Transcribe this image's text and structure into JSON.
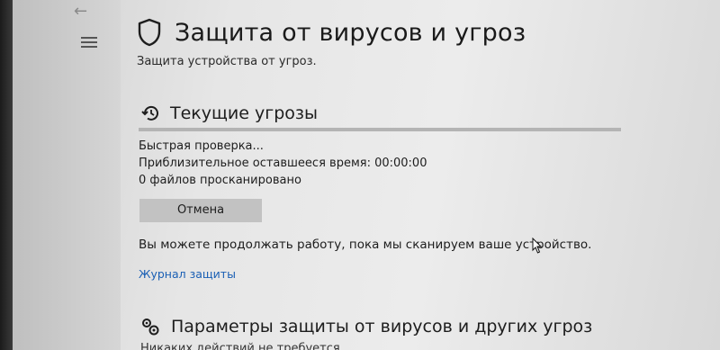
{
  "nav": {
    "back_glyph": "←",
    "back_icon": "back-arrow-icon",
    "menu_icon": "hamburger-menu-icon"
  },
  "page": {
    "title": "Защита от вирусов и угроз",
    "title_icon": "shield-icon",
    "subtitle": "Защита устройства от угроз."
  },
  "current_threats": {
    "title": "Текущие угрозы",
    "icon": "refresh-clock-icon",
    "scan_status": "Быстрая проверка...",
    "time_remaining": "Приблизительное оставшееся время: 00:00:00",
    "files_scanned": "0 файлов просканировано",
    "cancel_label": "Отмена",
    "info": "Вы можете продолжать работу, пока мы сканируем ваше устройство.",
    "history_link": "Журнал защиты"
  },
  "settings": {
    "title": "Параметры защиты от вирусов и других угроз",
    "icon": "settings-gears-icon",
    "status": "Никаких действий не требуется."
  },
  "colors": {
    "link": "#1a5fb4",
    "button_bg": "#c2c2c2",
    "divider": "#b4b4b4"
  }
}
